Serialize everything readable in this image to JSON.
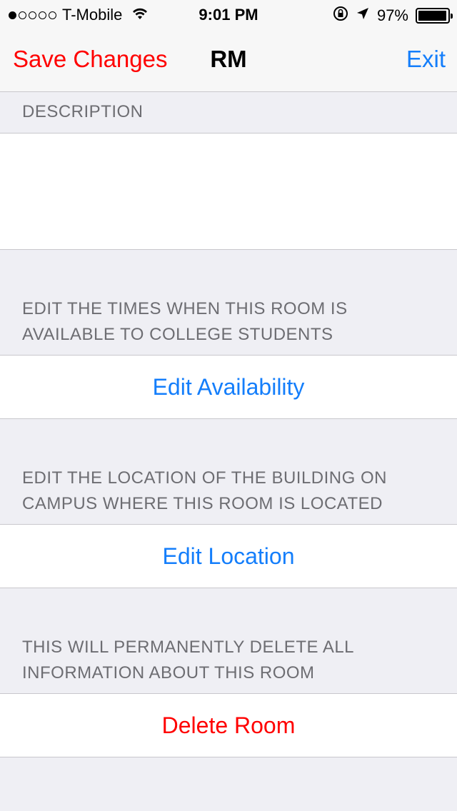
{
  "status_bar": {
    "signal_dots_filled": 1,
    "signal_dots_total": 5,
    "carrier": "T-Mobile",
    "time": "9:01 PM",
    "battery_percent": "97%",
    "battery_level": 0.97
  },
  "nav": {
    "left_label": "Save Changes",
    "title": "RM",
    "right_label": "Exit"
  },
  "description": {
    "header": "DESCRIPTION",
    "value": "",
    "placeholder": ""
  },
  "availability": {
    "header_line1": "EDIT THE TIMES WHEN THIS ROOM IS",
    "header_line2": "AVAILABLE TO COLLEGE STUDENTS",
    "button_label": "Edit Availability"
  },
  "location": {
    "header_line1": "EDIT THE LOCATION OF THE BUILDING ON",
    "header_line2": "CAMPUS WHERE THIS ROOM IS LOCATED",
    "button_label": "Edit Location"
  },
  "delete": {
    "header_line1": "THIS WILL PERMANENTLY DELETE ALL",
    "header_line2": "INFORMATION ABOUT THIS ROOM",
    "button_label": "Delete Room"
  },
  "colors": {
    "accent_blue": "#147efb",
    "destructive_red": "#ff0000",
    "background": "#efeff4"
  }
}
